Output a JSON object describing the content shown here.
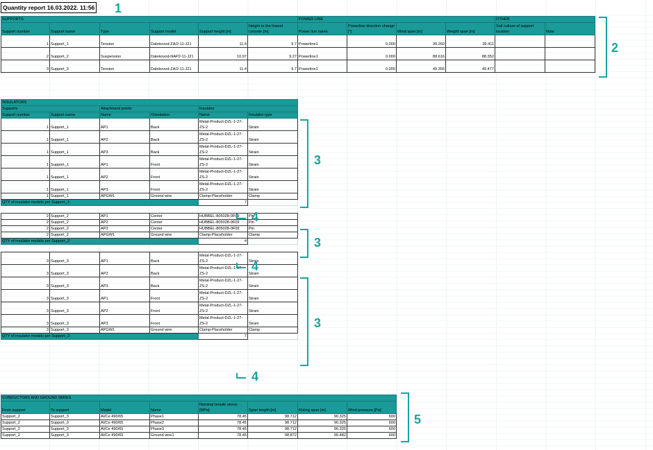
{
  "title": "Quantity report 16.03.2022. 11:56",
  "supports": {
    "groups": [
      "SUPPORTS",
      "POWER LINE",
      "OTHER"
    ],
    "headers": [
      "Support number",
      "Support name",
      "Type",
      "Support model",
      "Support height [m]",
      "Height to the lowest console [m]",
      "Power line name",
      "Powerline direction change [°]",
      "Wind span [m]",
      "Weight span [m]",
      "Soil culture of support location",
      "Note"
    ],
    "rows": [
      [
        "1",
        "Support_1",
        "Tension",
        "Dalekovod-ZA/2-11-J21",
        "11.4",
        "9.7",
        "Powerline1",
        "0.000",
        "39.260",
        "39.411",
        "",
        ""
      ],
      [
        "2",
        "Support_2",
        "Suspension",
        "Dalekovod-NAP2-11-J21",
        "10.97",
        "9.27",
        "Powerline1",
        "0.000",
        "88.616",
        "88.352",
        "",
        ""
      ],
      [
        "3",
        "Support_3",
        "Tension",
        "Dalekovod-ZA/2-11-J21",
        "11.4",
        "9.7",
        "Powerline1",
        "0.000",
        "49.356",
        "49.477",
        "",
        ""
      ]
    ]
  },
  "insulators": {
    "title": "INSULATORS",
    "groups": [
      "Supports",
      "Attachment points",
      "Insulator"
    ],
    "headers": [
      "Support number",
      "Support name",
      "Name",
      "Orientation",
      "Name",
      "Insulator type"
    ],
    "blocks": [
      {
        "rows": [
          [
            "1",
            "Support_1",
            "AP1",
            "Back",
            "Metal-Product-DZL-1-27-ZS-2",
            "Strain"
          ],
          [
            "1",
            "Support_1",
            "AP2",
            "Back",
            "Metal-Product-DZL-1-27-ZS-2",
            "Strain"
          ],
          [
            "1",
            "Support_1",
            "AP3",
            "Back",
            "Metal-Product-DZL-1-27-ZS-2",
            "Strain"
          ],
          [
            "1",
            "Support_1",
            "AP1",
            "Front",
            "Metal-Product-DZL-1-27-ZS-2",
            "Strain"
          ],
          [
            "1",
            "Support_1",
            "AP2",
            "Front",
            "Metal-Product-DZL-1-27-ZS-2",
            "Strain"
          ],
          [
            "1",
            "Support_1",
            "AP3",
            "Front",
            "Metal-Product-DZL-1-27-ZS-2",
            "Strain"
          ],
          [
            "1",
            "Support_1",
            "APGW1",
            "Ground wire",
            "Clamp-Placeholder",
            "Clamp"
          ]
        ],
        "qty_label": "QTY of insulator models per Support_1:",
        "qty": "7"
      },
      {
        "rows": [
          [
            "2",
            "Support_2",
            "AP1",
            "Center",
            "HUBBEL-805028-0F09",
            "Pin"
          ],
          [
            "2",
            "Support_2",
            "AP2",
            "Center",
            "HUBBEL-805028-0F09",
            "Pin"
          ],
          [
            "2",
            "Support_2",
            "AP3",
            "Center",
            "HUBBEL-805028-0F09",
            "Pin"
          ],
          [
            "2",
            "Support_2",
            "APGW1",
            "Ground wire",
            "Clamp-Placeholder",
            "Clamp"
          ]
        ],
        "qty_label": "QTY of insulator models per Support_2:",
        "qty": "4"
      },
      {
        "rows": [
          [
            "3",
            "Support_3",
            "AP1",
            "Back",
            "Metal-Product-DZL-1-27-ZS-2",
            "Strain"
          ],
          [
            "3",
            "Support_3",
            "AP2",
            "Back",
            "Metal-Product-DZL-1-27-ZS-2",
            "Strain"
          ],
          [
            "3",
            "Support_3",
            "AP3",
            "Back",
            "Metal-Product-DZL-1-27-ZS-2",
            "Strain"
          ],
          [
            "3",
            "Support_3",
            "AP1",
            "Front",
            "Metal-Product-DZL-1-27-ZS-2",
            "Strain"
          ],
          [
            "3",
            "Support_3",
            "AP2",
            "Front",
            "Metal-Product-DZL-1-27-ZS-2",
            "Strain"
          ],
          [
            "3",
            "Support_3",
            "AP3",
            "Front",
            "Metal-Product-DZL-1-27-ZS-2",
            "Strain"
          ],
          [
            "3",
            "Support_3",
            "APGW1",
            "Ground wire",
            "Clamp-Placeholder",
            "Clamp"
          ]
        ],
        "qty_label": "QTY of insulator models per Support_3:",
        "qty": "7"
      }
    ]
  },
  "conductors": {
    "title": "CONDUCTORS AND GROUND WIRES",
    "headers": [
      "From support",
      "To support",
      "Model",
      "Name",
      "Nominal tensile stress [MPa]",
      "Span length [m]",
      "Ruling span [m]",
      "Wind pressure [Pa]"
    ],
    "rows": [
      [
        "Support_2",
        "Support_3",
        "Al/Ce 490/65",
        "Phase1",
        "78.45",
        "98.712",
        "90.325",
        "600"
      ],
      [
        "Support_2",
        "Support_3",
        "Al/Ce 490/65",
        "Phase2",
        "78.45",
        "98.712",
        "90.325",
        "600"
      ],
      [
        "Support_2",
        "Support_3",
        "Al/Ce 490/65",
        "Phase3",
        "78.45",
        "98.712",
        "90.325",
        "600"
      ],
      [
        "Support_2",
        "Support_3",
        "Al/Ce 490/65",
        "Ground wire1",
        "78.45",
        "98.872",
        "90.482",
        "600"
      ]
    ]
  },
  "callouts": [
    "1",
    "2",
    "3",
    "3",
    "3",
    "4",
    "4",
    "4",
    "5"
  ],
  "colors": {
    "header_fill": "#1a9a98",
    "callout": "#1aa3a0"
  }
}
